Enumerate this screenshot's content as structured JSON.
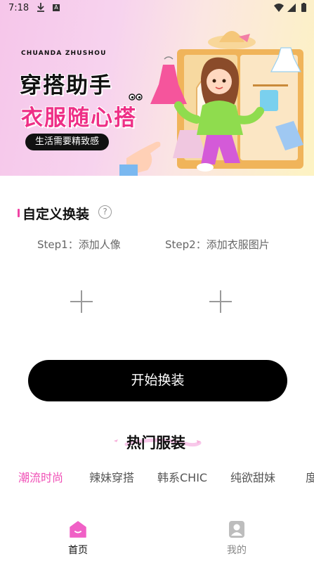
{
  "status_bar": {
    "time": "7:18",
    "a_badge": "A",
    "icons": [
      "download-icon",
      "a-badge-icon",
      "wifi-icon",
      "signal-icon",
      "battery-icon"
    ]
  },
  "banner": {
    "brand_en": "CHUANDA ZHUSHOU",
    "title": "穿搭助手",
    "subtitle": "衣服随心搭",
    "tagline": "生活需要精致感"
  },
  "custom_section": {
    "title": "自定义换装",
    "help_glyph": "?",
    "step1_label": "Step1：添加人像",
    "step2_label": "Step2：添加衣服图片"
  },
  "start_button": "开始换装",
  "hot_section": {
    "title": "热门服装",
    "tabs": [
      "潮流时尚",
      "辣妹穿搭",
      "韩系CHIC",
      "纯欲甜妹",
      "度"
    ],
    "active_tab_index": 0
  },
  "bottom_nav": {
    "home_label": "首页",
    "mine_label": "我的"
  },
  "colors": {
    "accent_pink": "#f04fb6",
    "brand_magenta": "#ee2f86",
    "button_black": "#000000"
  }
}
